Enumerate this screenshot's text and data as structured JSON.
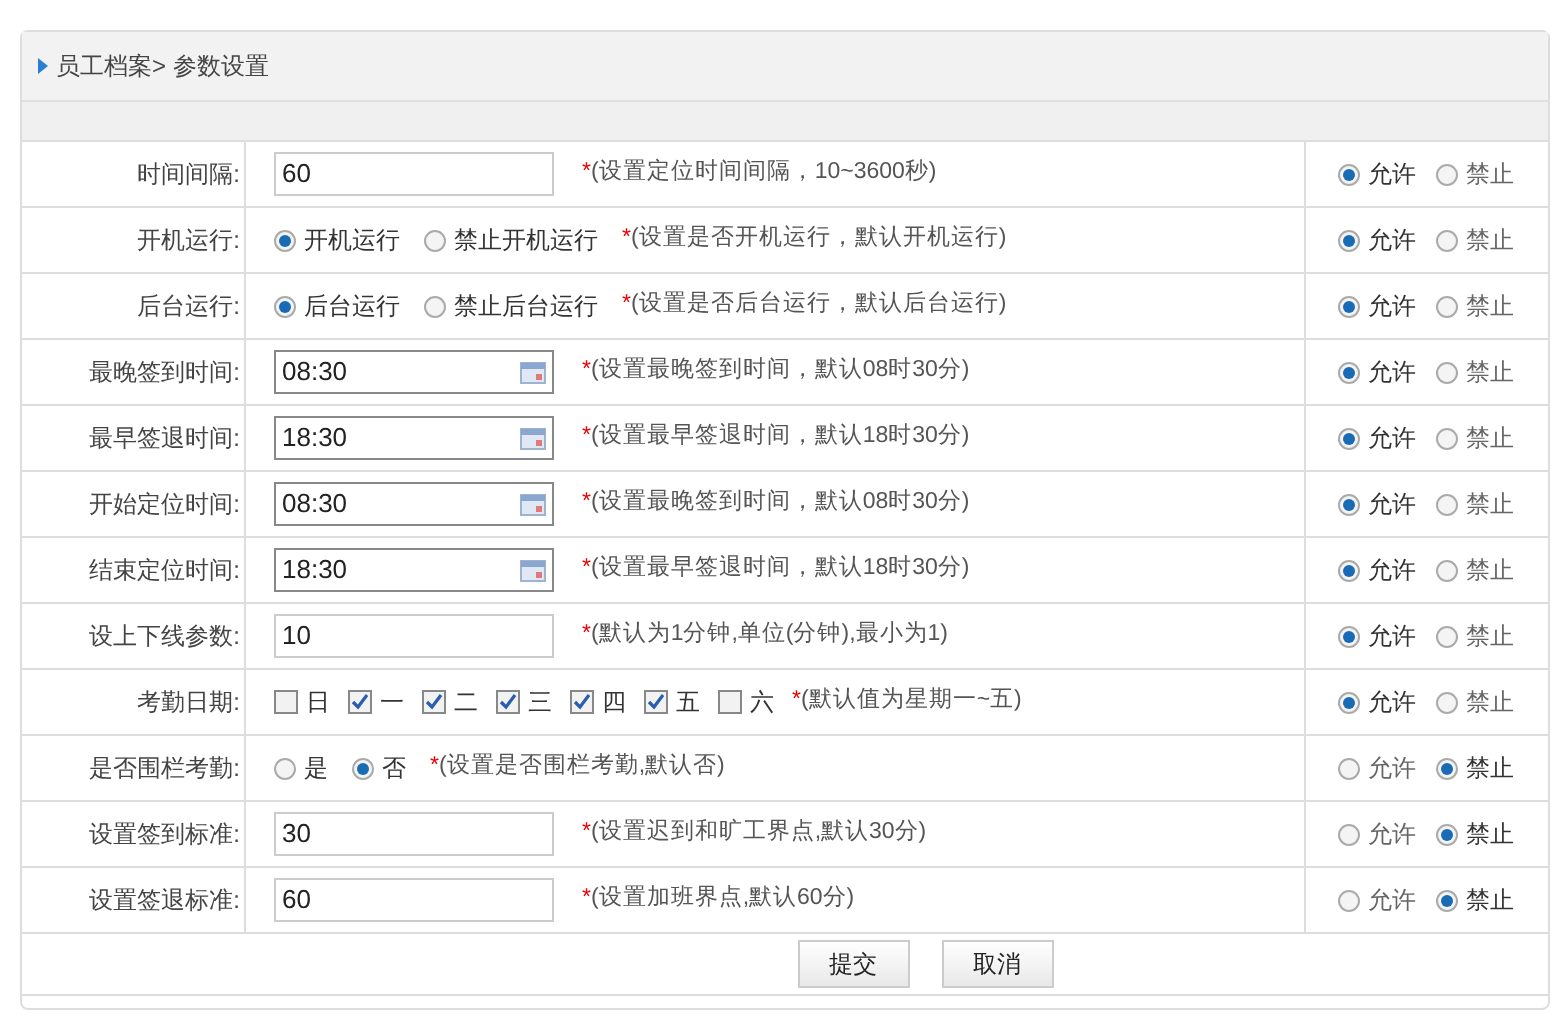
{
  "breadcrumb": "员工档案> 参数设置",
  "rows": [
    {
      "label": "时间间隔:",
      "kind": "text",
      "value": "60",
      "mark": "*",
      "note": "(设置定位时间间隔，10~3600秒)",
      "permission": [
        {
          "label": "允许",
          "selected": true
        },
        {
          "label": "禁止",
          "selected": false
        }
      ]
    },
    {
      "label": "开机运行:",
      "kind": "radio",
      "options": [
        {
          "label": "开机运行",
          "selected": true
        },
        {
          "label": "禁止开机运行",
          "selected": false
        }
      ],
      "mark": "*",
      "note": "(设置是否开机运行，默认开机运行)",
      "permission": [
        {
          "label": "允许",
          "selected": true
        },
        {
          "label": "禁止",
          "selected": false
        }
      ]
    },
    {
      "label": "后台运行:",
      "kind": "radio",
      "options": [
        {
          "label": "后台运行",
          "selected": true
        },
        {
          "label": "禁止后台运行",
          "selected": false
        }
      ],
      "mark": "*",
      "note": "(设置是否后台运行，默认后台运行)",
      "permission": [
        {
          "label": "允许",
          "selected": true
        },
        {
          "label": "禁止",
          "selected": false
        }
      ]
    },
    {
      "label": "最晚签到时间:",
      "kind": "date",
      "value": "08:30",
      "mark": "*",
      "note": "(设置最晚签到时间，默认08时30分)",
      "permission": [
        {
          "label": "允许",
          "selected": true
        },
        {
          "label": "禁止",
          "selected": false
        }
      ]
    },
    {
      "label": "最早签退时间:",
      "kind": "date",
      "value": "18:30",
      "mark": "*",
      "note": "(设置最早签退时间，默认18时30分)",
      "permission": [
        {
          "label": "允许",
          "selected": true
        },
        {
          "label": "禁止",
          "selected": false
        }
      ]
    },
    {
      "label": "开始定位时间:",
      "kind": "date",
      "value": "08:30",
      "mark": "*",
      "note": "(设置最晚签到时间，默认08时30分)",
      "permission": [
        {
          "label": "允许",
          "selected": true
        },
        {
          "label": "禁止",
          "selected": false
        }
      ]
    },
    {
      "label": "结束定位时间:",
      "kind": "date",
      "value": "18:30",
      "mark": "*",
      "note": "(设置最早签退时间，默认18时30分)",
      "permission": [
        {
          "label": "允许",
          "selected": true
        },
        {
          "label": "禁止",
          "selected": false
        }
      ]
    },
    {
      "label": "设上下线参数:",
      "kind": "text",
      "value": "10",
      "mark": "*",
      "note": "(默认为1分钟,单位(分钟),最小为1)",
      "permission": [
        {
          "label": "允许",
          "selected": true
        },
        {
          "label": "禁止",
          "selected": false
        }
      ]
    },
    {
      "label": "考勤日期:",
      "kind": "checkbox",
      "options": [
        {
          "label": "日",
          "checked": false
        },
        {
          "label": "一",
          "checked": true
        },
        {
          "label": "二",
          "checked": true
        },
        {
          "label": "三",
          "checked": true
        },
        {
          "label": "四",
          "checked": true
        },
        {
          "label": "五",
          "checked": true
        },
        {
          "label": "六",
          "checked": false
        }
      ],
      "mark": "*",
      "note": "(默认值为星期一~五)",
      "permission": [
        {
          "label": "允许",
          "selected": true
        },
        {
          "label": "禁止",
          "selected": false
        }
      ]
    },
    {
      "label": "是否围栏考勤:",
      "kind": "radio",
      "options": [
        {
          "label": "是",
          "selected": false
        },
        {
          "label": "否",
          "selected": true
        }
      ],
      "mark": "*",
      "note": "(设置是否围栏考勤,默认否)",
      "permission": [
        {
          "label": "允许",
          "selected": false
        },
        {
          "label": "禁止",
          "selected": true
        }
      ]
    },
    {
      "label": "设置签到标准:",
      "kind": "text",
      "value": "30",
      "mark": "*",
      "note": "(设置迟到和旷工界点,默认30分)",
      "permission": [
        {
          "label": "允许",
          "selected": false
        },
        {
          "label": "禁止",
          "selected": true
        }
      ]
    },
    {
      "label": "设置签退标准:",
      "kind": "text",
      "value": "60",
      "mark": "*",
      "note": "(设置加班界点,默认60分)",
      "permission": [
        {
          "label": "允许",
          "selected": false
        },
        {
          "label": "禁止",
          "selected": true
        }
      ]
    }
  ],
  "buttons": [
    "提交",
    "取消"
  ]
}
